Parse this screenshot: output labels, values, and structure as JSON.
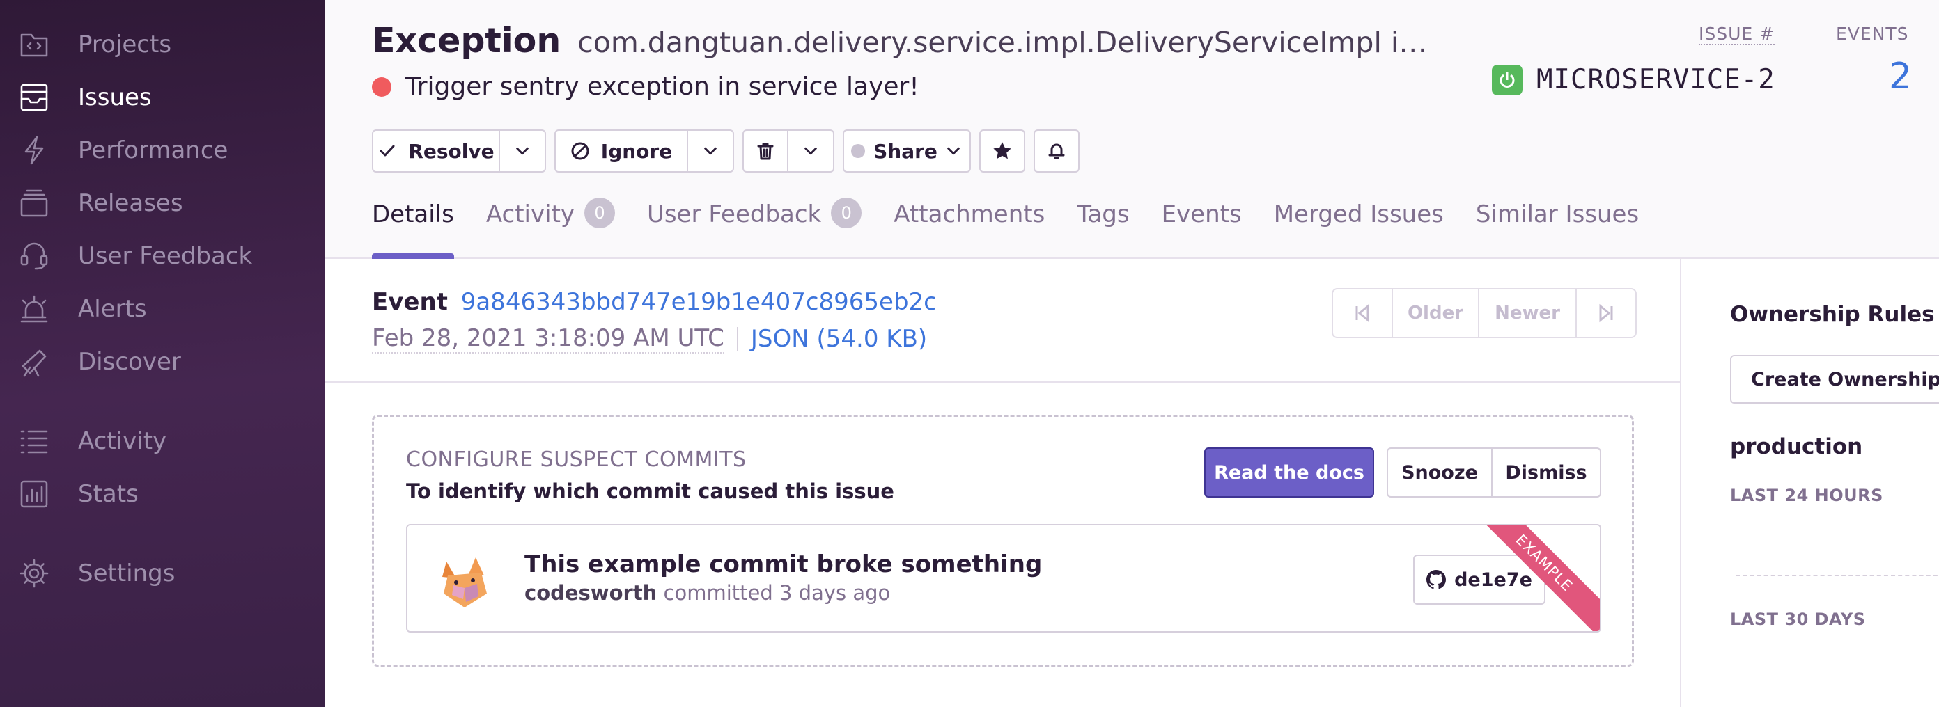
{
  "sidebar": {
    "items": [
      {
        "label": "Projects",
        "icon": "projects-icon",
        "active": false
      },
      {
        "label": "Issues",
        "icon": "issues-icon",
        "active": true
      },
      {
        "label": "Performance",
        "icon": "performance-icon",
        "active": false
      },
      {
        "label": "Releases",
        "icon": "releases-icon",
        "active": false
      },
      {
        "label": "User Feedback",
        "icon": "user-feedback-icon",
        "active": false
      },
      {
        "label": "Alerts",
        "icon": "alerts-icon",
        "active": false
      },
      {
        "label": "Discover",
        "icon": "discover-icon",
        "active": false
      },
      {
        "label": "Activity",
        "icon": "activity-icon",
        "active": false
      },
      {
        "label": "Stats",
        "icon": "stats-icon",
        "active": false
      },
      {
        "label": "Settings",
        "icon": "settings-icon",
        "active": false
      }
    ]
  },
  "header": {
    "title": "Exception",
    "culprit": "com.dangtuan.delivery.service.impl.DeliveryServiceImpl in triggerException",
    "message": "Trigger sentry exception in service layer!",
    "issue_label": "ISSUE #",
    "issue_id": "MICROSERVICE-2",
    "events_label": "EVENTS",
    "events_count": "2",
    "actions": {
      "resolve": "Resolve",
      "ignore": "Ignore",
      "share": "Share"
    },
    "tabs": [
      {
        "label": "Details",
        "badge": null,
        "active": true
      },
      {
        "label": "Activity",
        "badge": "0",
        "active": false
      },
      {
        "label": "User Feedback",
        "badge": "0",
        "active": false
      },
      {
        "label": "Attachments",
        "badge": null,
        "active": false
      },
      {
        "label": "Tags",
        "badge": null,
        "active": false
      },
      {
        "label": "Events",
        "badge": null,
        "active": false
      },
      {
        "label": "Merged Issues",
        "badge": null,
        "active": false
      },
      {
        "label": "Similar Issues",
        "badge": null,
        "active": false
      }
    ]
  },
  "event": {
    "label": "Event",
    "id": "9a846343bbd747e19b1e407c8965eb2c",
    "date": "Feb 28, 2021 3:18:09 AM UTC",
    "json_link": "JSON (54.0 KB)",
    "pager": {
      "older": "Older",
      "newer": "Newer"
    }
  },
  "suspect_commits": {
    "title": "CONFIGURE SUSPECT COMMITS",
    "subtitle": "To identify which commit caused this issue",
    "read_docs": "Read the docs",
    "snooze": "Snooze",
    "dismiss": "Dismiss",
    "commit": {
      "message": "This example commit broke something",
      "author": "codesworth",
      "when": "committed 3 days ago",
      "sha": "de1e7e",
      "ribbon": "EXAMPLE"
    }
  },
  "right_sidebar": {
    "ownership_title": "Ownership Rules",
    "create_rule": "Create Ownership Rule",
    "environment": "production",
    "last_24": "LAST 24 HOURS",
    "last_30": "LAST 30 DAYS"
  },
  "colors": {
    "accent": "#6c5fc7",
    "link": "#3d74db",
    "error_dot": "#f05b5e",
    "project_icon": "#57b95c",
    "ribbon": "#e1567c"
  }
}
